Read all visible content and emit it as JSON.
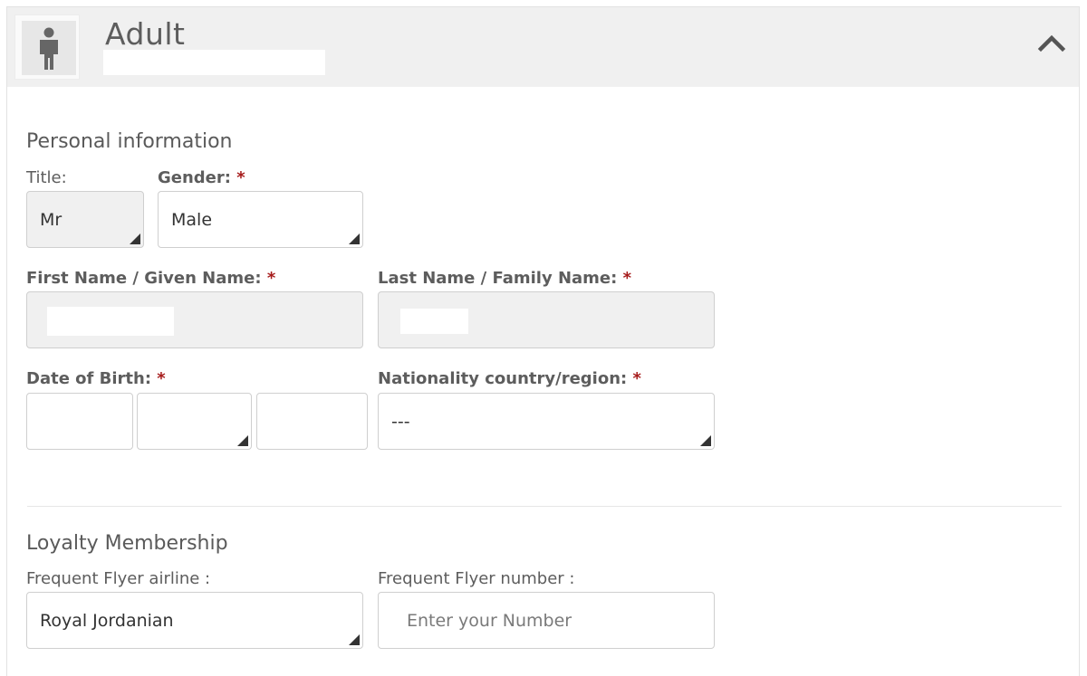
{
  "header": {
    "title": "Adult",
    "avatar_icon": "person-icon",
    "collapse_icon": "chevron-up-icon"
  },
  "personal": {
    "section_title": "Personal information",
    "title_label": "Title:",
    "title_value": "Mr",
    "gender_label": "Gender:",
    "gender_value": "Male",
    "first_name_label": "First Name / Given Name:",
    "last_name_label": "Last Name / Family Name:",
    "dob_label": "Date of Birth:",
    "nationality_label": "Nationality country/region:",
    "nationality_value": "---",
    "required_mark": "*"
  },
  "loyalty": {
    "section_title": "Loyalty Membership",
    "airline_label": "Frequent Flyer airline :",
    "airline_value": "Royal Jordanian",
    "number_label": "Frequent Flyer number :",
    "number_placeholder": "Enter your Number"
  },
  "colors": {
    "header_bg": "#f0f0f0",
    "required": "#a61b1b",
    "field_border": "#cfcfcf",
    "disabled_field_bg": "#f0f0f0"
  }
}
